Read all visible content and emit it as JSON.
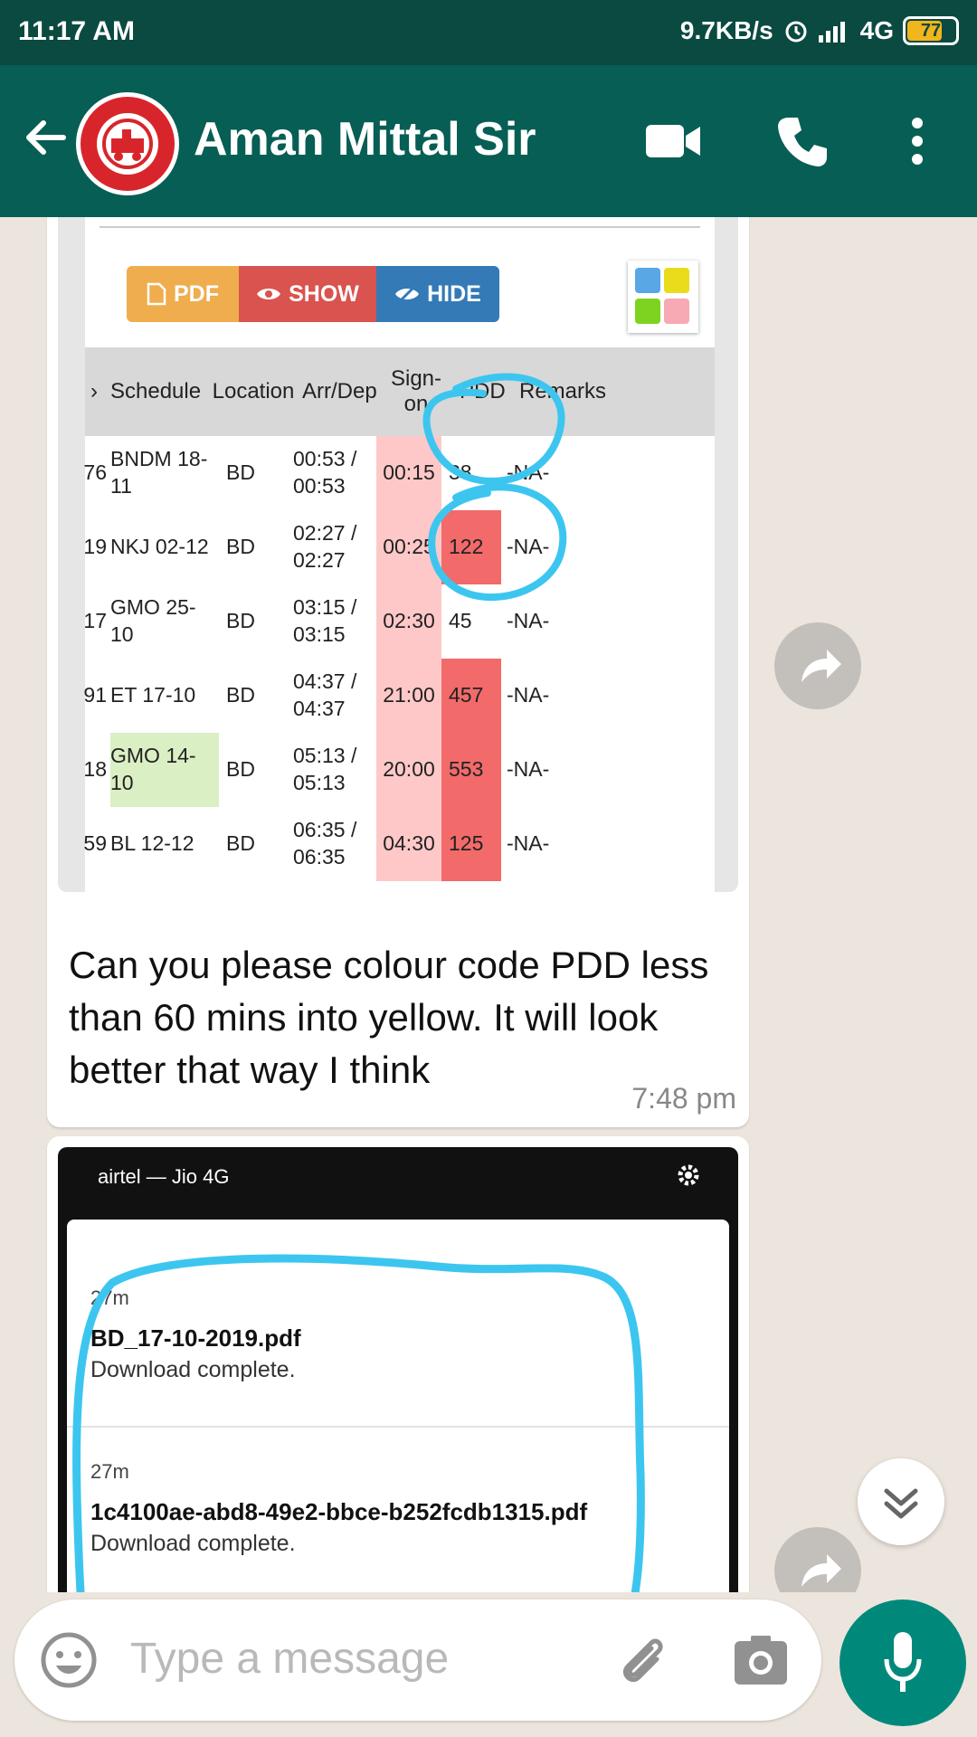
{
  "status_bar": {
    "time": "11:17 AM",
    "speed": "9.7KB/s",
    "network": "4G",
    "battery": "77"
  },
  "header": {
    "contact_name": "Aman Mittal Sir"
  },
  "messages": [
    {
      "screenshot": {
        "buttons": [
          "PDF",
          "SHOW",
          "HIDE"
        ],
        "columns": [
          "Schedule",
          "Location",
          "Arr/Dep",
          "Sign-on",
          "PDD",
          "Remarks"
        ],
        "rows": [
          {
            "no": "76",
            "schedule": "BNDM 18-11",
            "location": "BD",
            "arrdep": "00:53 / 00:53",
            "signon": "00:15",
            "pdd": "38",
            "remarks": "-NA-"
          },
          {
            "no": "19",
            "schedule": "NKJ 02-12",
            "location": "BD",
            "arrdep": "02:27 / 02:27",
            "signon": "00:25",
            "pdd": "122",
            "remarks": "-NA-"
          },
          {
            "no": "17",
            "schedule": "GMO 25-10",
            "location": "BD",
            "arrdep": "03:15 / 03:15",
            "signon": "02:30",
            "pdd": "45",
            "remarks": "-NA-"
          },
          {
            "no": "91",
            "schedule": "ET 17-10",
            "location": "BD",
            "arrdep": "04:37 / 04:37",
            "signon": "21:00",
            "pdd": "457",
            "remarks": "-NA-"
          },
          {
            "no": "18",
            "schedule": "GMO 14-10",
            "location": "BD",
            "arrdep": "05:13 / 05:13",
            "signon": "20:00",
            "pdd": "553",
            "remarks": "-NA-"
          },
          {
            "no": "59",
            "schedule": "BL 12-12",
            "location": "BD",
            "arrdep": "06:35 / 06:35",
            "signon": "04:30",
            "pdd": "125",
            "remarks": "-NA-"
          }
        ]
      },
      "text": "Can you please colour code PDD less than 60 mins into yellow. It will look better that way I think",
      "time": "7:48 pm"
    },
    {
      "screenshot": {
        "carrier": "airtel — Jio 4G",
        "notifications": [
          {
            "time": "27m",
            "title": "BD_17-10-2019.pdf",
            "subtitle": "Download complete."
          },
          {
            "time": "27m",
            "title": "1c4100ae-abd8-49e2-bbce-b252fcdb1315.pdf",
            "subtitle": "Download complete."
          }
        ]
      }
    }
  ],
  "input": {
    "placeholder": "Type a message"
  },
  "colors": {
    "header": "#075e54",
    "status_bar": "#0b4a40",
    "chat_bg": "#ece5dd",
    "accent": "#00897b",
    "annotation": "#3cc6ef"
  }
}
